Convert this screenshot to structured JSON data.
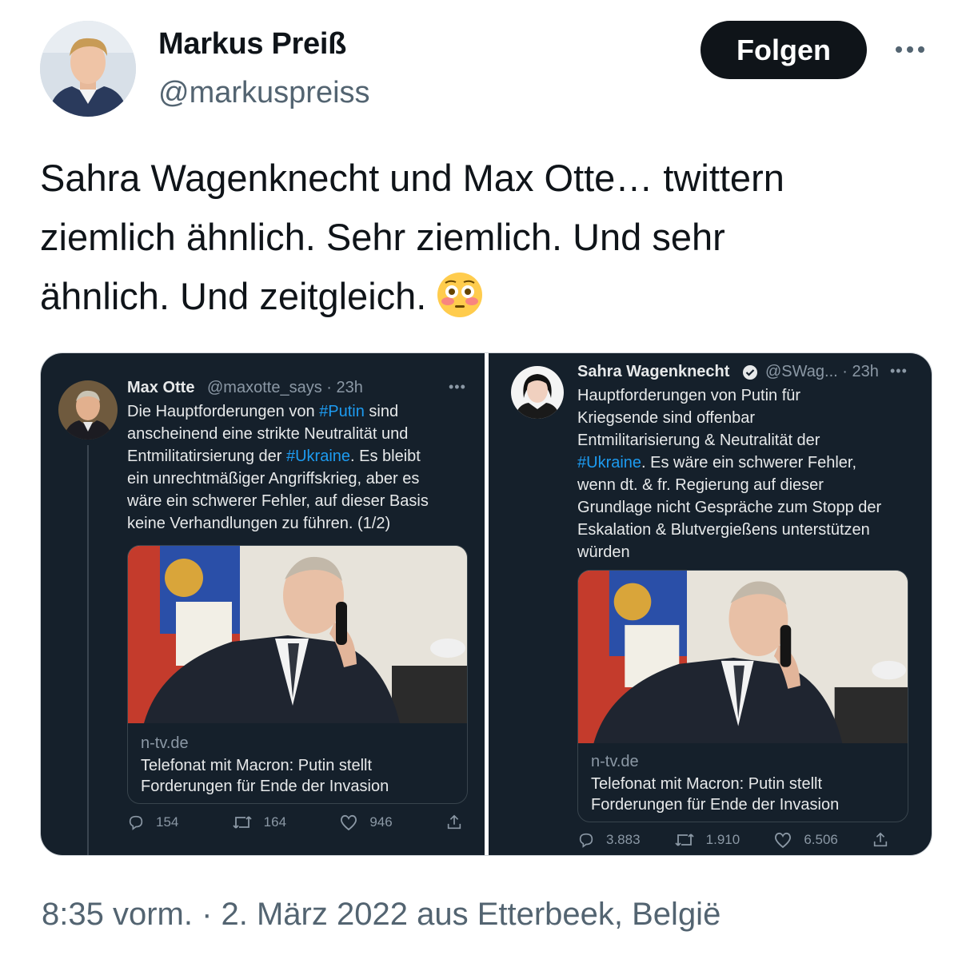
{
  "author": {
    "display_name": "Markus Preiß",
    "handle": "@markuspreiss",
    "follow_label": "Folgen"
  },
  "tweet": {
    "lines": [
      "Sahra Wagenknecht und Max Otte… twittern",
      "ziemlich ähnlich. Sehr ziemlich. Und sehr",
      "ähnlich. Und zeitgleich."
    ],
    "emoji": "flushed-face",
    "timestamp": "8:35 vorm. · 2. März 2022 aus Etterbeek, België"
  },
  "left_tweet": {
    "name": "Max Otte",
    "meta": "@maxotte_says · 23h",
    "lines": [
      {
        "before": "Die Hauptforderungen von ",
        "tag": "#Putin",
        "after": " sind"
      },
      {
        "before": "anscheinend eine strikte Neutralität und",
        "tag": "",
        "after": ""
      },
      {
        "before": "Entmilitatirsierung der ",
        "tag": "#Ukraine",
        "after": ". Es bleibt"
      },
      {
        "before": "ein unrechtmäßiger Angriffskrieg, aber es",
        "tag": "",
        "after": ""
      },
      {
        "before": "wäre ein schwerer Fehler, auf dieser Basis",
        "tag": "",
        "after": ""
      },
      {
        "before": "keine Verhandlungen zu führen. (1/2)",
        "tag": "",
        "after": ""
      }
    ],
    "card": {
      "domain": "n-tv.de",
      "title_lines": [
        "Telefonat mit Macron: Putin stellt",
        "Forderungen für Ende der Invasion"
      ]
    },
    "stats": {
      "replies": "154",
      "retweets": "164",
      "likes": "946"
    }
  },
  "right_tweet": {
    "name": "Sahra Wagenknecht",
    "meta": "@SWag... · 23h",
    "lines": [
      {
        "before": "Hauptforderungen von Putin für",
        "tag": "",
        "after": ""
      },
      {
        "before": "Kriegsende sind offenbar",
        "tag": "",
        "after": ""
      },
      {
        "before": "Entmilitarisierung & Neutralität der",
        "tag": "",
        "after": ""
      },
      {
        "before": "",
        "tag": "#Ukraine",
        "after": ". Es wäre ein schwerer Fehler,"
      },
      {
        "before": "wenn dt. & fr. Regierung auf dieser",
        "tag": "",
        "after": ""
      },
      {
        "before": "Grundlage nicht Gespräche zum Stopp der",
        "tag": "",
        "after": ""
      },
      {
        "before": "Eskalation & Blutvergießens unterstützen",
        "tag": "",
        "after": ""
      },
      {
        "before": "würden",
        "tag": "",
        "after": ""
      }
    ],
    "card": {
      "domain": "n-tv.de",
      "title_lines": [
        "Telefonat mit Macron: Putin stellt",
        "Forderungen für Ende der Invasion"
      ]
    },
    "stats": {
      "replies": "3.883",
      "retweets": "1.910",
      "likes": "6.506"
    }
  },
  "colors": {
    "panel_bg": "#15202b",
    "hashtag": "#1d9bf0",
    "follow_bg": "#0f1419",
    "secondary_text": "#536471"
  }
}
